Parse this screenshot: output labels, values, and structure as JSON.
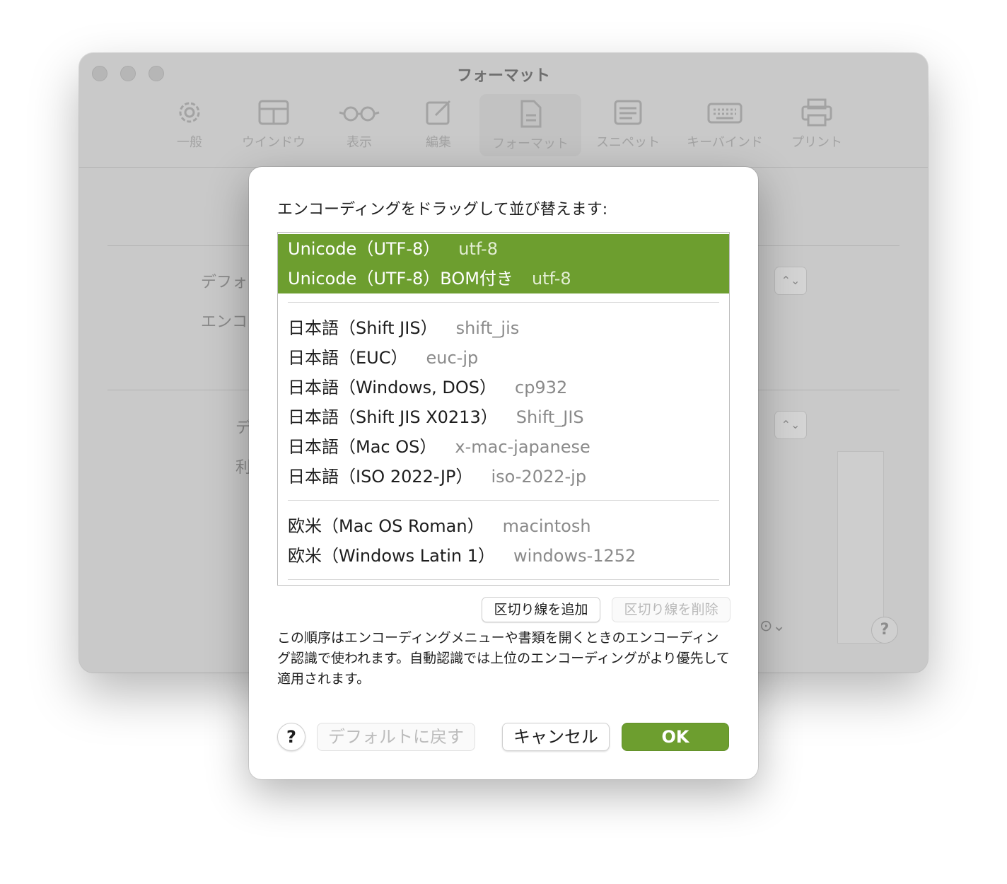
{
  "window": {
    "title": "フォーマット",
    "toolbar": [
      {
        "label": "一般",
        "icon": "gear-icon"
      },
      {
        "label": "ウインドウ",
        "icon": "window-icon"
      },
      {
        "label": "表示",
        "icon": "glasses-icon"
      },
      {
        "label": "編集",
        "icon": "edit-icon"
      },
      {
        "label": "フォーマット",
        "icon": "document-icon",
        "active": true
      },
      {
        "label": "スニペット",
        "icon": "snippet-icon"
      },
      {
        "label": "キーバインド",
        "icon": "keyboard-icon"
      },
      {
        "label": "プリント",
        "icon": "printer-icon"
      }
    ],
    "background_labels": [
      "デフォ",
      "エンコ",
      "デ",
      "利"
    ]
  },
  "sheet": {
    "instruction": "エンコーディングをドラッグして並び替えます:",
    "encodings": [
      {
        "name": "Unicode（UTF-8）",
        "code": "utf-8",
        "selected": true
      },
      {
        "name": "Unicode（UTF-8）BOM付き",
        "code": "utf-8",
        "selected": true
      },
      {
        "name": "日本語（Shift JIS）",
        "code": "shift_jis"
      },
      {
        "name": "日本語（EUC）",
        "code": "euc-jp"
      },
      {
        "name": "日本語（Windows, DOS）",
        "code": "cp932"
      },
      {
        "name": "日本語（Shift JIS X0213）",
        "code": "Shift_JIS"
      },
      {
        "name": "日本語（Mac OS）",
        "code": "x-mac-japanese"
      },
      {
        "name": "日本語（ISO 2022-JP）",
        "code": "iso-2022-jp"
      },
      {
        "name": "欧米（Mac OS Roman）",
        "code": "macintosh"
      },
      {
        "name": "欧米（Windows Latin 1）",
        "code": "windows-1252"
      }
    ],
    "add_separator": "区切り線を追加",
    "remove_separator": "区切り線を削除",
    "description": "この順序はエンコーディングメニューや書類を開くときのエンコーディング認識で使われます。自動認識では上位のエンコーディングがより優先して適用されます。",
    "help": "?",
    "restore_default": "デフォルトに戻す",
    "cancel": "キャンセル",
    "ok": "OK",
    "accent_color": "#6d9e2f"
  }
}
